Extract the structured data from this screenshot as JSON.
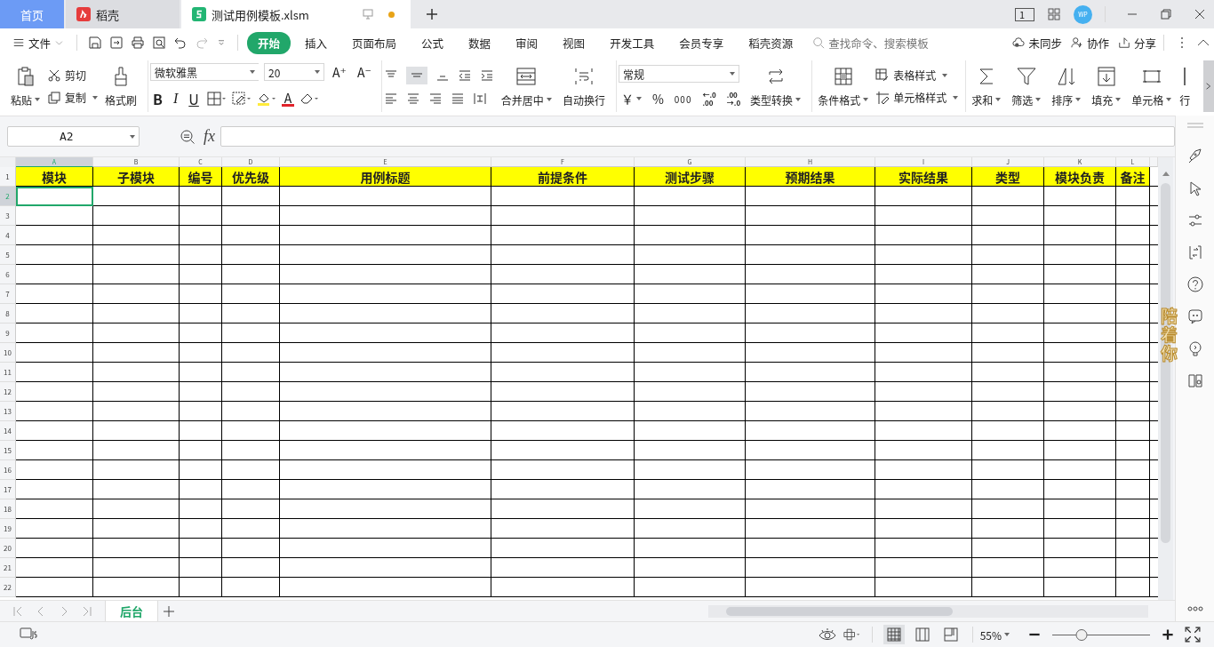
{
  "tabs": [
    {
      "label": "首页",
      "kind": "home",
      "selected": false
    },
    {
      "label": "稻壳",
      "kind": "docer",
      "selected": false
    },
    {
      "label": "测试用例模板.xlsm",
      "kind": "sheet",
      "selected": true
    }
  ],
  "title_bar": {
    "page_number": "1",
    "avatar": "WP"
  },
  "menu": {
    "file": "文件",
    "tabs": [
      {
        "label": "开始",
        "selected": true
      },
      {
        "label": "插入",
        "selected": false
      },
      {
        "label": "页面布局",
        "selected": false
      },
      {
        "label": "公式",
        "selected": false
      },
      {
        "label": "数据",
        "selected": false
      },
      {
        "label": "审阅",
        "selected": false
      },
      {
        "label": "视图",
        "selected": false
      },
      {
        "label": "开发工具",
        "selected": false
      },
      {
        "label": "会员专享",
        "selected": false
      },
      {
        "label": "稻壳资源",
        "selected": false
      }
    ],
    "search": {
      "placeholder": "查找命令、搜索模板"
    },
    "actions": [
      "未同步",
      "协作",
      "分享"
    ]
  },
  "ribbon": {
    "paste": "粘贴",
    "cut": "剪切",
    "copy": "复制",
    "format_painter": "格式刷",
    "font_name": "微软雅黑",
    "font_size": "20",
    "grow": "A⁺",
    "shrink": "A⁻",
    "bold": "B",
    "italic": "I",
    "underline": "U",
    "font_color": "A",
    "merge": "合并居中",
    "wrap": "自动换行",
    "number_format": "常规",
    "currency": "￥",
    "percent": "%",
    "thousands": "000",
    "inc_decimal": [
      "←.0",
      ".00"
    ],
    "dec_decimal": [
      ".00",
      "→.0"
    ],
    "convert": "类型转换",
    "conditional": "条件格式",
    "table_style": "表格样式",
    "cell_style": "单元格样式",
    "sum": "求和",
    "filter": "筛选",
    "sort": "排序",
    "fill": "填充",
    "cells": "单元格",
    "rows": "行"
  },
  "name_box": "A2",
  "fx": "fx",
  "columns": [
    {
      "letter": "A",
      "title": "模块",
      "selected": true
    },
    {
      "letter": "B",
      "title": "子模块",
      "selected": false
    },
    {
      "letter": "C",
      "title": "编号",
      "selected": false
    },
    {
      "letter": "D",
      "title": "优先级",
      "selected": false
    },
    {
      "letter": "E",
      "title": "用例标题",
      "selected": false
    },
    {
      "letter": "F",
      "title": "前提条件",
      "selected": false
    },
    {
      "letter": "G",
      "title": "测试步骤",
      "selected": false
    },
    {
      "letter": "H",
      "title": "预期结果",
      "selected": false
    },
    {
      "letter": "I",
      "title": "实际结果",
      "selected": false
    },
    {
      "letter": "J",
      "title": "类型",
      "selected": false
    },
    {
      "letter": "K",
      "title": "模块负责",
      "selected": false
    },
    {
      "letter": "L",
      "title": "备注",
      "selected": false
    }
  ],
  "rows": [
    {
      "number": "1",
      "selected": false
    },
    {
      "number": "2",
      "selected": true
    },
    {
      "number": "3",
      "selected": false
    },
    {
      "number": "4",
      "selected": false
    },
    {
      "number": "5",
      "selected": false
    },
    {
      "number": "6",
      "selected": false
    },
    {
      "number": "7",
      "selected": false
    },
    {
      "number": "8",
      "selected": false
    },
    {
      "number": "9",
      "selected": false
    },
    {
      "number": "10",
      "selected": false
    },
    {
      "number": "11",
      "selected": false
    },
    {
      "number": "12",
      "selected": false
    },
    {
      "number": "13",
      "selected": false
    },
    {
      "number": "14",
      "selected": false
    },
    {
      "number": "15",
      "selected": false
    },
    {
      "number": "16",
      "selected": false
    },
    {
      "number": "17",
      "selected": false
    },
    {
      "number": "18",
      "selected": false
    },
    {
      "number": "19",
      "selected": false
    },
    {
      "number": "20",
      "selected": false
    },
    {
      "number": "21",
      "selected": false
    },
    {
      "number": "22",
      "selected": false
    }
  ],
  "sheets": [
    {
      "label": "后台",
      "selected": true
    }
  ],
  "overlay_text": "陪着你",
  "status_bar": {
    "zoom": "55%",
    "zoom_level": {
      "level": 0.3
    }
  }
}
